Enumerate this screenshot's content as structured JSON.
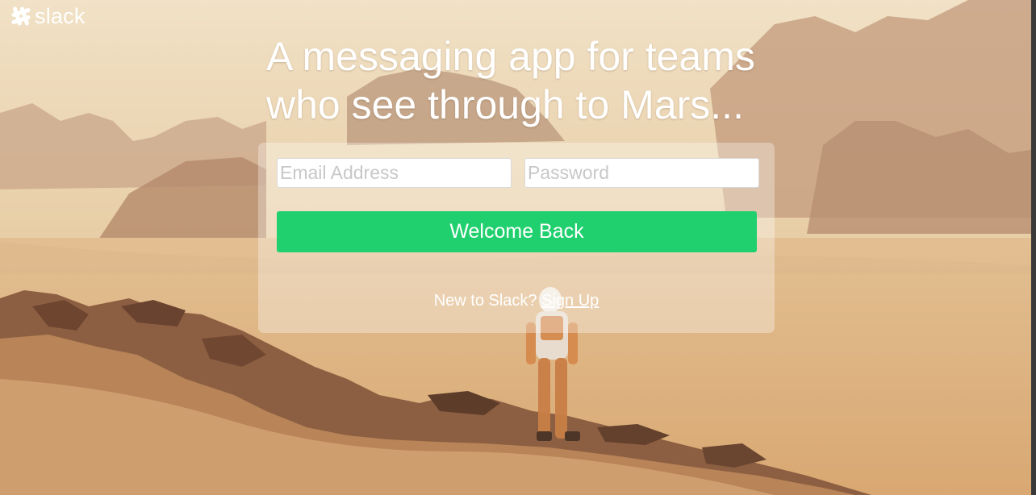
{
  "brand": {
    "logo_text": "slack",
    "logo_icon": "slack-hash-icon"
  },
  "hero": {
    "headline_line1": "A messaging app for teams",
    "headline_line2": "who see through to Mars..."
  },
  "login_form": {
    "email_placeholder": "Email Address",
    "email_value": "",
    "password_placeholder": "Password",
    "password_value": "",
    "submit_label": "Welcome Back",
    "signup_prompt": "New to Slack?",
    "signup_link": "Sign Up"
  },
  "colors": {
    "button_green": "#20d06e",
    "text": "#ffffff"
  }
}
